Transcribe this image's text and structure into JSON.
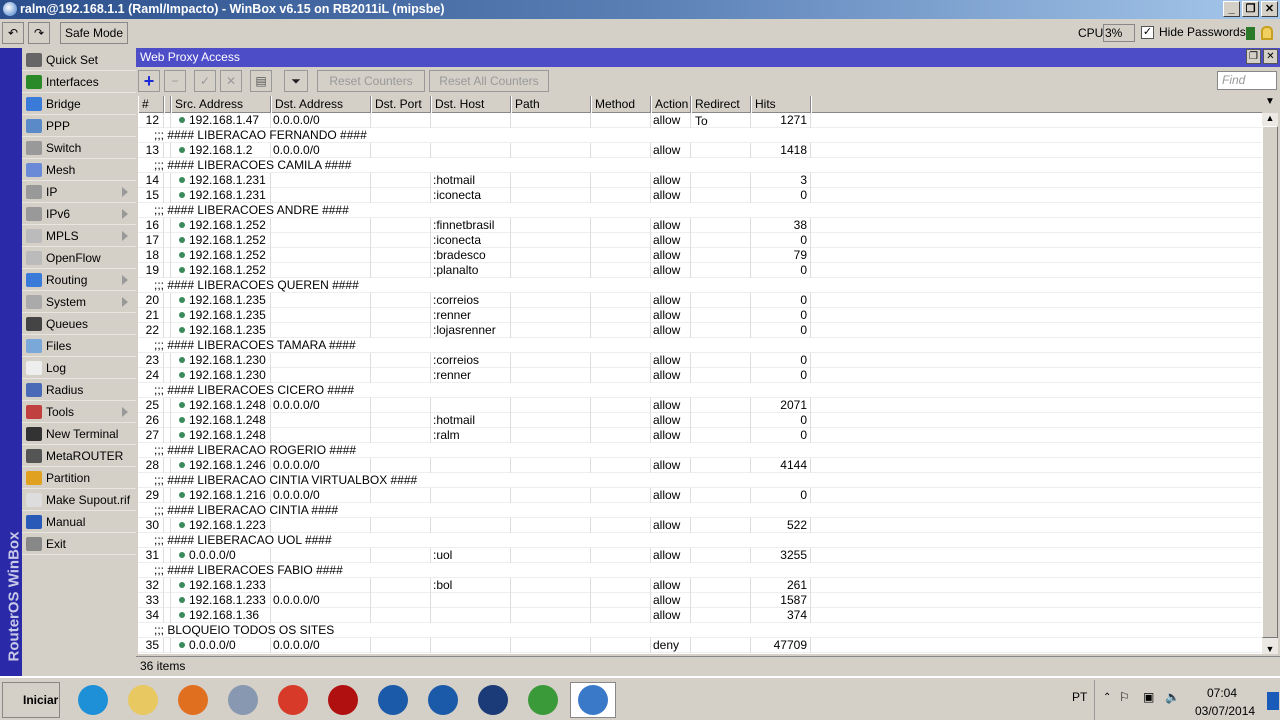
{
  "window": {
    "title": "ralm@192.168.1.1 (Raml/Impacto) - WinBox v6.15 on RB2011iL (mipsbe)",
    "min": "_",
    "max": "❐",
    "close": "✕"
  },
  "toolbar": {
    "undo": "↶",
    "redo": "↷",
    "safe_mode": "Safe Mode",
    "cpu_label": "CPU:",
    "cpu_value": "3%",
    "hide_passwords": "Hide Passwords",
    "hide_passwords_checked": true
  },
  "sidebar": {
    "brand": "RouterOS WinBox",
    "items": [
      {
        "label": "Quick Set",
        "color": "#666"
      },
      {
        "label": "Interfaces",
        "color": "#2a8a2a"
      },
      {
        "label": "Bridge",
        "color": "#3a7ad8"
      },
      {
        "label": "PPP",
        "color": "#5a8ac8"
      },
      {
        "label": "Switch",
        "color": "#999"
      },
      {
        "label": "Mesh",
        "color": "#6a8ad8"
      },
      {
        "label": "IP",
        "color": "#999",
        "sub": true
      },
      {
        "label": "IPv6",
        "color": "#999",
        "sub": true
      },
      {
        "label": "MPLS",
        "color": "#bbb",
        "sub": true
      },
      {
        "label": "OpenFlow",
        "color": "#bbb"
      },
      {
        "label": "Routing",
        "color": "#3a7ad8",
        "sub": true
      },
      {
        "label": "System",
        "color": "#aaa",
        "sub": true
      },
      {
        "label": "Queues",
        "color": "#444"
      },
      {
        "label": "Files",
        "color": "#7aa8d8"
      },
      {
        "label": "Log",
        "color": "#eee"
      },
      {
        "label": "Radius",
        "color": "#4a6ab8"
      },
      {
        "label": "Tools",
        "color": "#c04040",
        "sub": true
      },
      {
        "label": "New Terminal",
        "color": "#333"
      },
      {
        "label": "MetaROUTER",
        "color": "#555"
      },
      {
        "label": "Partition",
        "color": "#e0a020"
      },
      {
        "label": "Make Supout.rif",
        "color": "#ddd"
      },
      {
        "label": "Manual",
        "color": "#2a5ab8"
      },
      {
        "label": "Exit",
        "color": "#888"
      }
    ]
  },
  "panel": {
    "title": "Web Proxy Access",
    "add": "+",
    "remove": "−",
    "enable": "✓",
    "disable": "✕",
    "comment": "▤",
    "filter": "⏷",
    "reset_counters": "Reset Counters",
    "reset_all_counters": "Reset All Counters",
    "find_placeholder": "Find",
    "status": "36 items"
  },
  "columns": [
    "#",
    "",
    "Src. Address",
    "Dst. Address",
    "Dst. Port",
    "Dst. Host",
    "Path",
    "Method",
    "Action",
    "Redirect To",
    "Hits"
  ],
  "rows": [
    {
      "n": "12",
      "src": "192.168.1.47",
      "dst": "0.0.0.0/0",
      "host": "",
      "action": "allow",
      "hits": "1271"
    },
    {
      "comment": ";;; #### LIBERACAO FERNANDO ####"
    },
    {
      "n": "13",
      "src": "192.168.1.2",
      "dst": "0.0.0.0/0",
      "host": "",
      "action": "allow",
      "hits": "1418"
    },
    {
      "comment": ";;; #### LIBERACOES CAMILA ####"
    },
    {
      "n": "14",
      "src": "192.168.1.231",
      "dst": "",
      "host": ":hotmail",
      "action": "allow",
      "hits": "3"
    },
    {
      "n": "15",
      "src": "192.168.1.231",
      "dst": "",
      "host": ":iconecta",
      "action": "allow",
      "hits": "0"
    },
    {
      "comment": ";;; #### LIBERACOES ANDRE ####"
    },
    {
      "n": "16",
      "src": "192.168.1.252",
      "dst": "",
      "host": ":finnetbrasil",
      "action": "allow",
      "hits": "38"
    },
    {
      "n": "17",
      "src": "192.168.1.252",
      "dst": "",
      "host": ":iconecta",
      "action": "allow",
      "hits": "0"
    },
    {
      "n": "18",
      "src": "192.168.1.252",
      "dst": "",
      "host": ":bradesco",
      "action": "allow",
      "hits": "79"
    },
    {
      "n": "19",
      "src": "192.168.1.252",
      "dst": "",
      "host": ":planalto",
      "action": "allow",
      "hits": "0"
    },
    {
      "comment": ";;; #### LIBERACOES QUEREN ####"
    },
    {
      "n": "20",
      "src": "192.168.1.235",
      "dst": "",
      "host": ":correios",
      "action": "allow",
      "hits": "0"
    },
    {
      "n": "21",
      "src": "192.168.1.235",
      "dst": "",
      "host": ":renner",
      "action": "allow",
      "hits": "0"
    },
    {
      "n": "22",
      "src": "192.168.1.235",
      "dst": "",
      "host": ":lojasrenner",
      "action": "allow",
      "hits": "0"
    },
    {
      "comment": ";;; #### LIBERACOES TAMARA ####"
    },
    {
      "n": "23",
      "src": "192.168.1.230",
      "dst": "",
      "host": ":correios",
      "action": "allow",
      "hits": "0"
    },
    {
      "n": "24",
      "src": "192.168.1.230",
      "dst": "",
      "host": ":renner",
      "action": "allow",
      "hits": "0"
    },
    {
      "comment": ";;; #### LIBERACOES CICERO ####"
    },
    {
      "n": "25",
      "src": "192.168.1.248",
      "dst": "0.0.0.0/0",
      "host": "",
      "action": "allow",
      "hits": "2071"
    },
    {
      "n": "26",
      "src": "192.168.1.248",
      "dst": "",
      "host": ":hotmail",
      "action": "allow",
      "hits": "0"
    },
    {
      "n": "27",
      "src": "192.168.1.248",
      "dst": "",
      "host": ":ralm",
      "action": "allow",
      "hits": "0"
    },
    {
      "comment": ";;; #### LIBERACAO ROGERIO ####"
    },
    {
      "n": "28",
      "src": "192.168.1.246",
      "dst": "0.0.0.0/0",
      "host": "",
      "action": "allow",
      "hits": "4144"
    },
    {
      "comment": ";;; #### LIBERACAO CINTIA VIRTUALBOX ####"
    },
    {
      "n": "29",
      "src": "192.168.1.216",
      "dst": "0.0.0.0/0",
      "host": "",
      "action": "allow",
      "hits": "0"
    },
    {
      "comment": ";;; #### LIBERACAO CINTIA ####"
    },
    {
      "n": "30",
      "src": "192.168.1.223",
      "dst": "",
      "host": "",
      "action": "allow",
      "hits": "522"
    },
    {
      "comment": ";;; #### LIEBERACAO UOL ####"
    },
    {
      "n": "31",
      "src": "0.0.0.0/0",
      "dst": "",
      "host": ":uol",
      "action": "allow",
      "hits": "3255"
    },
    {
      "comment": ";;; #### LIBERACOES FABIO ####"
    },
    {
      "n": "32",
      "src": "192.168.1.233",
      "dst": "",
      "host": ":bol",
      "action": "allow",
      "hits": "261"
    },
    {
      "n": "33",
      "src": "192.168.1.233",
      "dst": "0.0.0.0/0",
      "host": "",
      "action": "allow",
      "hits": "1587"
    },
    {
      "n": "34",
      "src": "192.168.1.36",
      "dst": "",
      "host": "",
      "action": "allow",
      "hits": "374"
    },
    {
      "comment": ";;; BLOQUEIO TODOS OS SITES"
    },
    {
      "n": "35",
      "src": "0.0.0.0/0",
      "dst": "0.0.0.0/0",
      "host": "",
      "action": "deny",
      "hits": "47709"
    }
  ],
  "taskbar": {
    "start": "Iniciar",
    "apps": [
      {
        "name": "internet-explorer",
        "color": "#1e90d8"
      },
      {
        "name": "file-explorer",
        "color": "#e8c860"
      },
      {
        "name": "media-player",
        "color": "#e07020"
      },
      {
        "name": "settings",
        "color": "#8898b0"
      },
      {
        "name": "chrome",
        "color": "#d83a2a"
      },
      {
        "name": "filezilla",
        "color": "#b01010"
      },
      {
        "name": "app-1",
        "color": "#1a5aa8"
      },
      {
        "name": "app-2",
        "color": "#1a5aa8"
      },
      {
        "name": "app-3",
        "color": "#1a3a78"
      },
      {
        "name": "editor",
        "color": "#3a9a3a"
      },
      {
        "name": "winbox",
        "color": "#3a78c8"
      }
    ],
    "lang": "PT",
    "time": "07:04",
    "date": "03/07/2014"
  }
}
